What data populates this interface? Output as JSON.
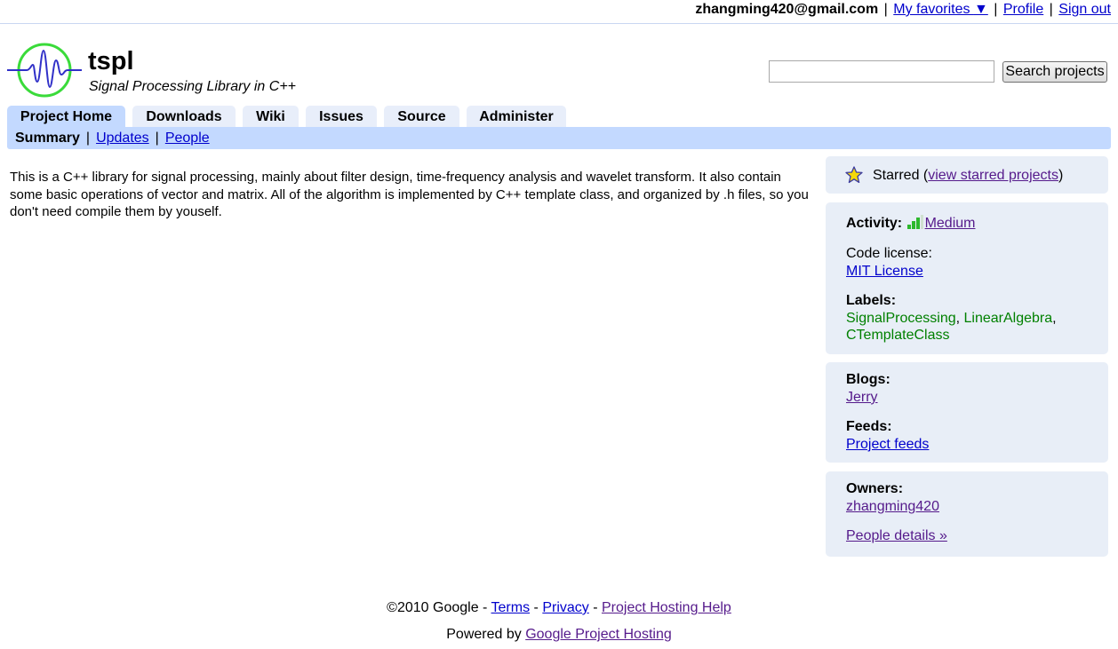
{
  "userbar": {
    "email": "zhangming420@gmail.com",
    "favorites": "My favorites",
    "favorites_arrow": "▼",
    "sep": "|",
    "profile": "Profile",
    "signout": "Sign out"
  },
  "project": {
    "name": "tspl",
    "summary": "Signal Processing Library in C++"
  },
  "search": {
    "value": "",
    "button": "Search projects"
  },
  "tabs": [
    {
      "label": "Project Home"
    },
    {
      "label": "Downloads"
    },
    {
      "label": "Wiki"
    },
    {
      "label": "Issues"
    },
    {
      "label": "Source"
    },
    {
      "label": "Administer"
    }
  ],
  "subnav": {
    "current": "Summary",
    "updates": "Updates",
    "people": "People",
    "sep": "|"
  },
  "description": "This is a C++ library for signal processing, mainly about filter design, time-frequency analysis and wavelet transform. It also contain some basic operations of vector and matrix. All of the algorithm is implemented by C++ template class, and organized by .h files, so you don't need compile them by youself.",
  "sidebar": {
    "starred": "Starred",
    "view_starred": "view starred projects",
    "activity_label": "Activity:",
    "activity_value": "Medium",
    "activity_level": "3 of 4 bars",
    "license_label": "Code license:",
    "license_value": "MIT License",
    "labels_label": "Labels:",
    "labels": [
      "SignalProcessing",
      "LinearAlgebra",
      "CTemplateClass"
    ],
    "blogs_label": "Blogs:",
    "blog": "Jerry",
    "feeds_label": "Feeds:",
    "feeds_value": "Project feeds",
    "owners_label": "Owners:",
    "owner": "zhangming420",
    "people_details": "People details »"
  },
  "footer": {
    "copyright": "©2010 Google",
    "terms": "Terms",
    "privacy": "Privacy",
    "help": "Project Hosting Help",
    "powered_by": "Powered by",
    "powered_link": "Google Project Hosting"
  },
  "colors": {
    "tab_bg": "#e8eefa",
    "tab_active": "#c3d9ff",
    "sidebar_bg": "#e8eef7",
    "link": "#0000cc",
    "label_green": "#008000"
  }
}
